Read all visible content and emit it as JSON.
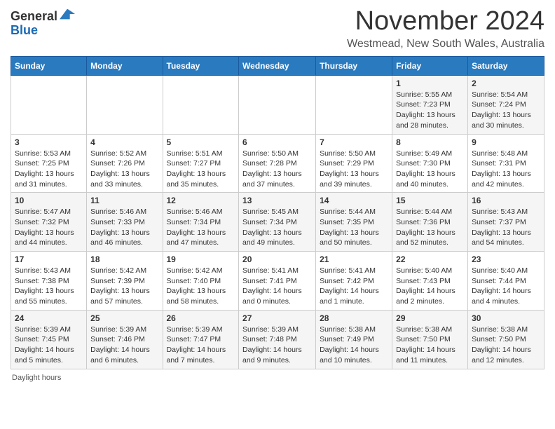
{
  "header": {
    "logo_general": "General",
    "logo_blue": "Blue",
    "month_title": "November 2024",
    "location": "Westmead, New South Wales, Australia"
  },
  "calendar": {
    "days_of_week": [
      "Sunday",
      "Monday",
      "Tuesday",
      "Wednesday",
      "Thursday",
      "Friday",
      "Saturday"
    ],
    "weeks": [
      [
        {
          "day": "",
          "info": ""
        },
        {
          "day": "",
          "info": ""
        },
        {
          "day": "",
          "info": ""
        },
        {
          "day": "",
          "info": ""
        },
        {
          "day": "",
          "info": ""
        },
        {
          "day": "1",
          "info": "Sunrise: 5:55 AM\nSunset: 7:23 PM\nDaylight: 13 hours and 28 minutes."
        },
        {
          "day": "2",
          "info": "Sunrise: 5:54 AM\nSunset: 7:24 PM\nDaylight: 13 hours and 30 minutes."
        }
      ],
      [
        {
          "day": "3",
          "info": "Sunrise: 5:53 AM\nSunset: 7:25 PM\nDaylight: 13 hours and 31 minutes."
        },
        {
          "day": "4",
          "info": "Sunrise: 5:52 AM\nSunset: 7:26 PM\nDaylight: 13 hours and 33 minutes."
        },
        {
          "day": "5",
          "info": "Sunrise: 5:51 AM\nSunset: 7:27 PM\nDaylight: 13 hours and 35 minutes."
        },
        {
          "day": "6",
          "info": "Sunrise: 5:50 AM\nSunset: 7:28 PM\nDaylight: 13 hours and 37 minutes."
        },
        {
          "day": "7",
          "info": "Sunrise: 5:50 AM\nSunset: 7:29 PM\nDaylight: 13 hours and 39 minutes."
        },
        {
          "day": "8",
          "info": "Sunrise: 5:49 AM\nSunset: 7:30 PM\nDaylight: 13 hours and 40 minutes."
        },
        {
          "day": "9",
          "info": "Sunrise: 5:48 AM\nSunset: 7:31 PM\nDaylight: 13 hours and 42 minutes."
        }
      ],
      [
        {
          "day": "10",
          "info": "Sunrise: 5:47 AM\nSunset: 7:32 PM\nDaylight: 13 hours and 44 minutes."
        },
        {
          "day": "11",
          "info": "Sunrise: 5:46 AM\nSunset: 7:33 PM\nDaylight: 13 hours and 46 minutes."
        },
        {
          "day": "12",
          "info": "Sunrise: 5:46 AM\nSunset: 7:34 PM\nDaylight: 13 hours and 47 minutes."
        },
        {
          "day": "13",
          "info": "Sunrise: 5:45 AM\nSunset: 7:34 PM\nDaylight: 13 hours and 49 minutes."
        },
        {
          "day": "14",
          "info": "Sunrise: 5:44 AM\nSunset: 7:35 PM\nDaylight: 13 hours and 50 minutes."
        },
        {
          "day": "15",
          "info": "Sunrise: 5:44 AM\nSunset: 7:36 PM\nDaylight: 13 hours and 52 minutes."
        },
        {
          "day": "16",
          "info": "Sunrise: 5:43 AM\nSunset: 7:37 PM\nDaylight: 13 hours and 54 minutes."
        }
      ],
      [
        {
          "day": "17",
          "info": "Sunrise: 5:43 AM\nSunset: 7:38 PM\nDaylight: 13 hours and 55 minutes."
        },
        {
          "day": "18",
          "info": "Sunrise: 5:42 AM\nSunset: 7:39 PM\nDaylight: 13 hours and 57 minutes."
        },
        {
          "day": "19",
          "info": "Sunrise: 5:42 AM\nSunset: 7:40 PM\nDaylight: 13 hours and 58 minutes."
        },
        {
          "day": "20",
          "info": "Sunrise: 5:41 AM\nSunset: 7:41 PM\nDaylight: 14 hours and 0 minutes."
        },
        {
          "day": "21",
          "info": "Sunrise: 5:41 AM\nSunset: 7:42 PM\nDaylight: 14 hours and 1 minute."
        },
        {
          "day": "22",
          "info": "Sunrise: 5:40 AM\nSunset: 7:43 PM\nDaylight: 14 hours and 2 minutes."
        },
        {
          "day": "23",
          "info": "Sunrise: 5:40 AM\nSunset: 7:44 PM\nDaylight: 14 hours and 4 minutes."
        }
      ],
      [
        {
          "day": "24",
          "info": "Sunrise: 5:39 AM\nSunset: 7:45 PM\nDaylight: 14 hours and 5 minutes."
        },
        {
          "day": "25",
          "info": "Sunrise: 5:39 AM\nSunset: 7:46 PM\nDaylight: 14 hours and 6 minutes."
        },
        {
          "day": "26",
          "info": "Sunrise: 5:39 AM\nSunset: 7:47 PM\nDaylight: 14 hours and 7 minutes."
        },
        {
          "day": "27",
          "info": "Sunrise: 5:39 AM\nSunset: 7:48 PM\nDaylight: 14 hours and 9 minutes."
        },
        {
          "day": "28",
          "info": "Sunrise: 5:38 AM\nSunset: 7:49 PM\nDaylight: 14 hours and 10 minutes."
        },
        {
          "day": "29",
          "info": "Sunrise: 5:38 AM\nSunset: 7:50 PM\nDaylight: 14 hours and 11 minutes."
        },
        {
          "day": "30",
          "info": "Sunrise: 5:38 AM\nSunset: 7:50 PM\nDaylight: 14 hours and 12 minutes."
        }
      ]
    ]
  },
  "footer": {
    "note": "Daylight hours"
  }
}
